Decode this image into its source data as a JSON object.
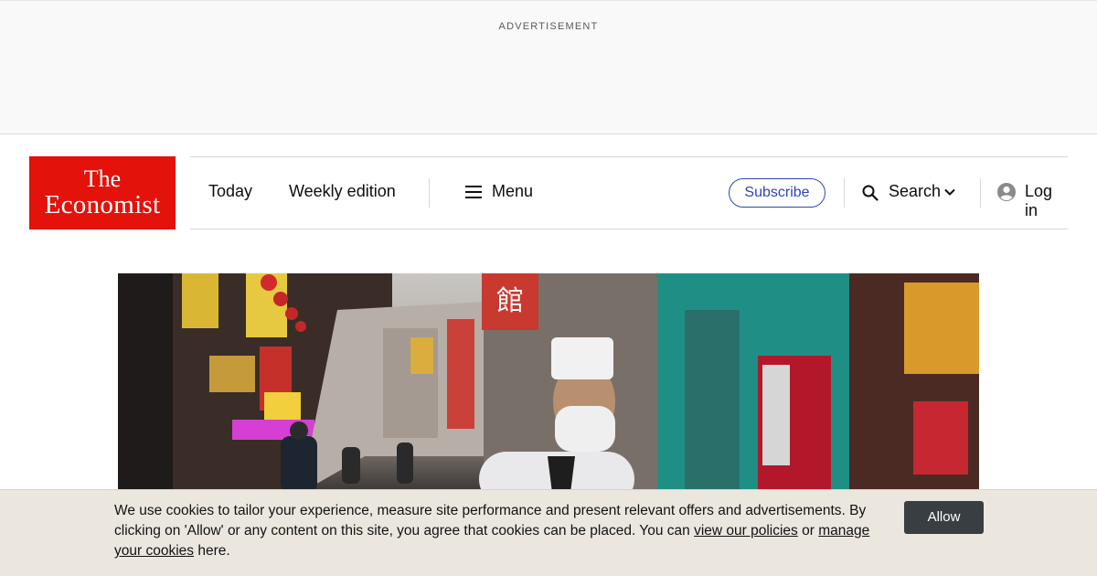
{
  "ad": {
    "label": "ADVERTISEMENT"
  },
  "logo": {
    "line1": "The",
    "line2": "Economist",
    "color": "#e3120b"
  },
  "nav": {
    "today": "Today",
    "weekly_edition": "Weekly edition",
    "menu": "Menu",
    "subscribe": "Subscribe",
    "search": "Search",
    "login": "Log in"
  },
  "icons": {
    "menu": "hamburger-icon",
    "search": "magnifier-icon",
    "chevron": "chevron-down-icon",
    "account": "user-circle-icon"
  },
  "colors": {
    "brand_red": "#e3120b",
    "subscribe_blue": "#2e45b8",
    "cookie_bg": "#ebe7df",
    "allow_bg": "#383e42"
  },
  "cookie": {
    "text_1": "We use cookies to tailor your experience, measure site performance and present relevant offers and advertisements. By clicking on 'Allow' or any content on this site, you agree that cookies can be placed. You can ",
    "link_policies": "view our policies",
    "text_2": " or ",
    "link_manage": "manage your cookies",
    "text_3": " here.",
    "allow": "Allow"
  },
  "hero_sign": "館"
}
